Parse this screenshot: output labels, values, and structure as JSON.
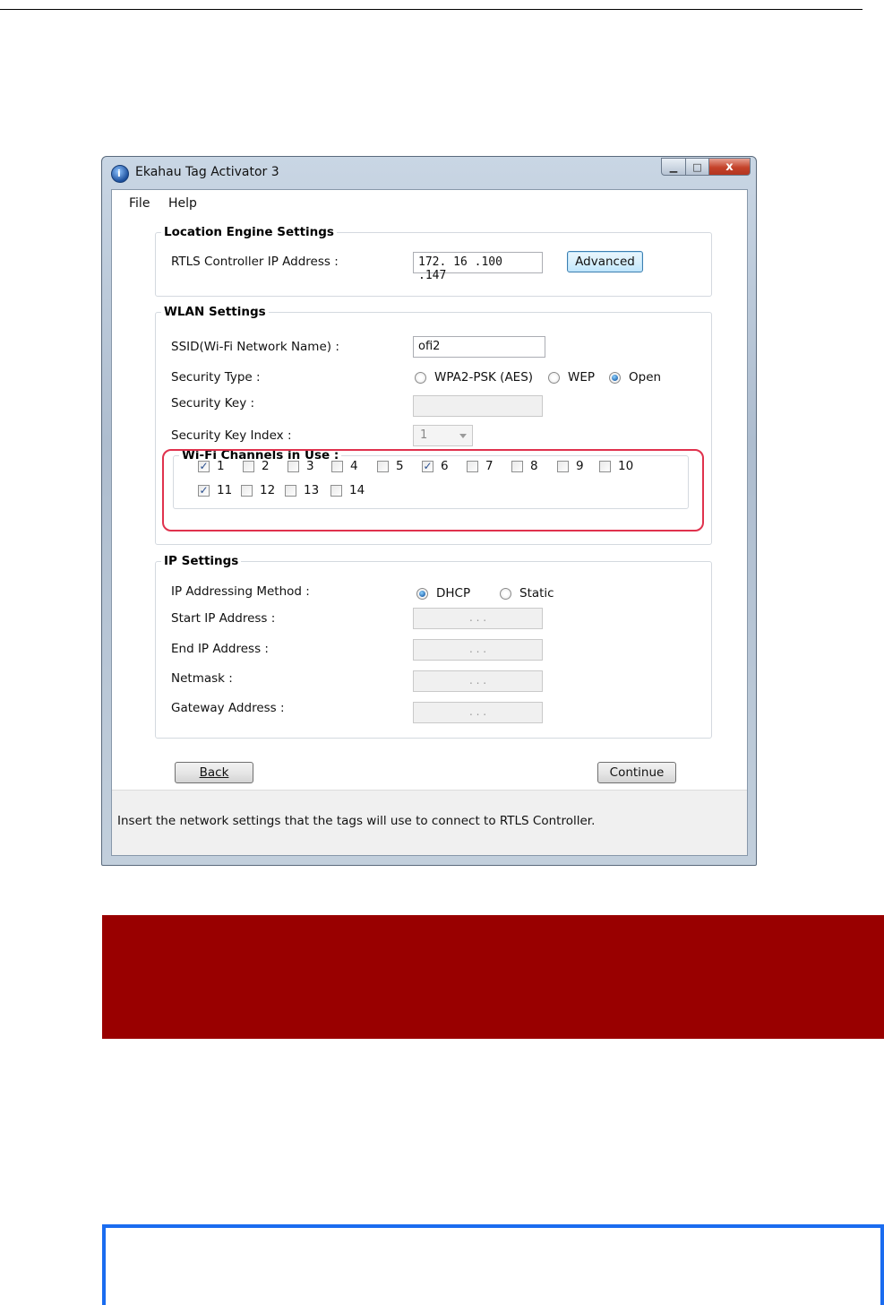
{
  "window": {
    "title": "Ekahau Tag  Activator 3",
    "caption_close": "x"
  },
  "menu": {
    "file": "File",
    "help": "Help"
  },
  "location_engine": {
    "legend": "Location Engine Settings",
    "rtls_label": "RTLS Controller IP Address :",
    "rtls_value": "172. 16 .100 .147",
    "advanced_button": "Advanced"
  },
  "wlan": {
    "legend": "WLAN Settings",
    "ssid_label": "SSID(Wi-Fi Network Name) :",
    "ssid_value": "ofi2",
    "security_type_label": "Security Type :",
    "security_options": [
      "WPA2-PSK (AES)",
      "WEP",
      "Open"
    ],
    "security_selected": "Open",
    "security_key_label": "Security Key :",
    "security_key_value": "",
    "key_index_label": "Security Key Index :",
    "key_index_value": "1",
    "channels_legend": "Wi-Fi Channels in Use :",
    "channels": [
      {
        "label": "1",
        "checked": true
      },
      {
        "label": "2",
        "checked": false
      },
      {
        "label": "3",
        "checked": false
      },
      {
        "label": "4",
        "checked": false
      },
      {
        "label": "5",
        "checked": false
      },
      {
        "label": "6",
        "checked": true
      },
      {
        "label": "7",
        "checked": false
      },
      {
        "label": "8",
        "checked": false
      },
      {
        "label": "9",
        "checked": false
      },
      {
        "label": "10",
        "checked": false
      },
      {
        "label": "11",
        "checked": true
      },
      {
        "label": "12",
        "checked": false
      },
      {
        "label": "13",
        "checked": false
      },
      {
        "label": "14",
        "checked": false
      }
    ],
    "checkmark": "✓"
  },
  "ip": {
    "legend": "IP Settings",
    "method_label": "IP Addressing Method :",
    "method_options": [
      "DHCP",
      "Static"
    ],
    "method_selected": "DHCP",
    "start_label": "Start IP Address :",
    "end_label": "End IP Address :",
    "netmask_label": "Netmask :",
    "gateway_label": "Gateway Address :",
    "empty_ip_dots": ".        .        ."
  },
  "footer": {
    "back_button": "Back",
    "continue_button": "Continue",
    "status_text": "Insert the network settings that the tags will use to connect to RTLS Controller."
  },
  "colors": {
    "highlight": "#e0324d",
    "red_banner": "#990000",
    "blue_box": "#1a6cf0"
  }
}
